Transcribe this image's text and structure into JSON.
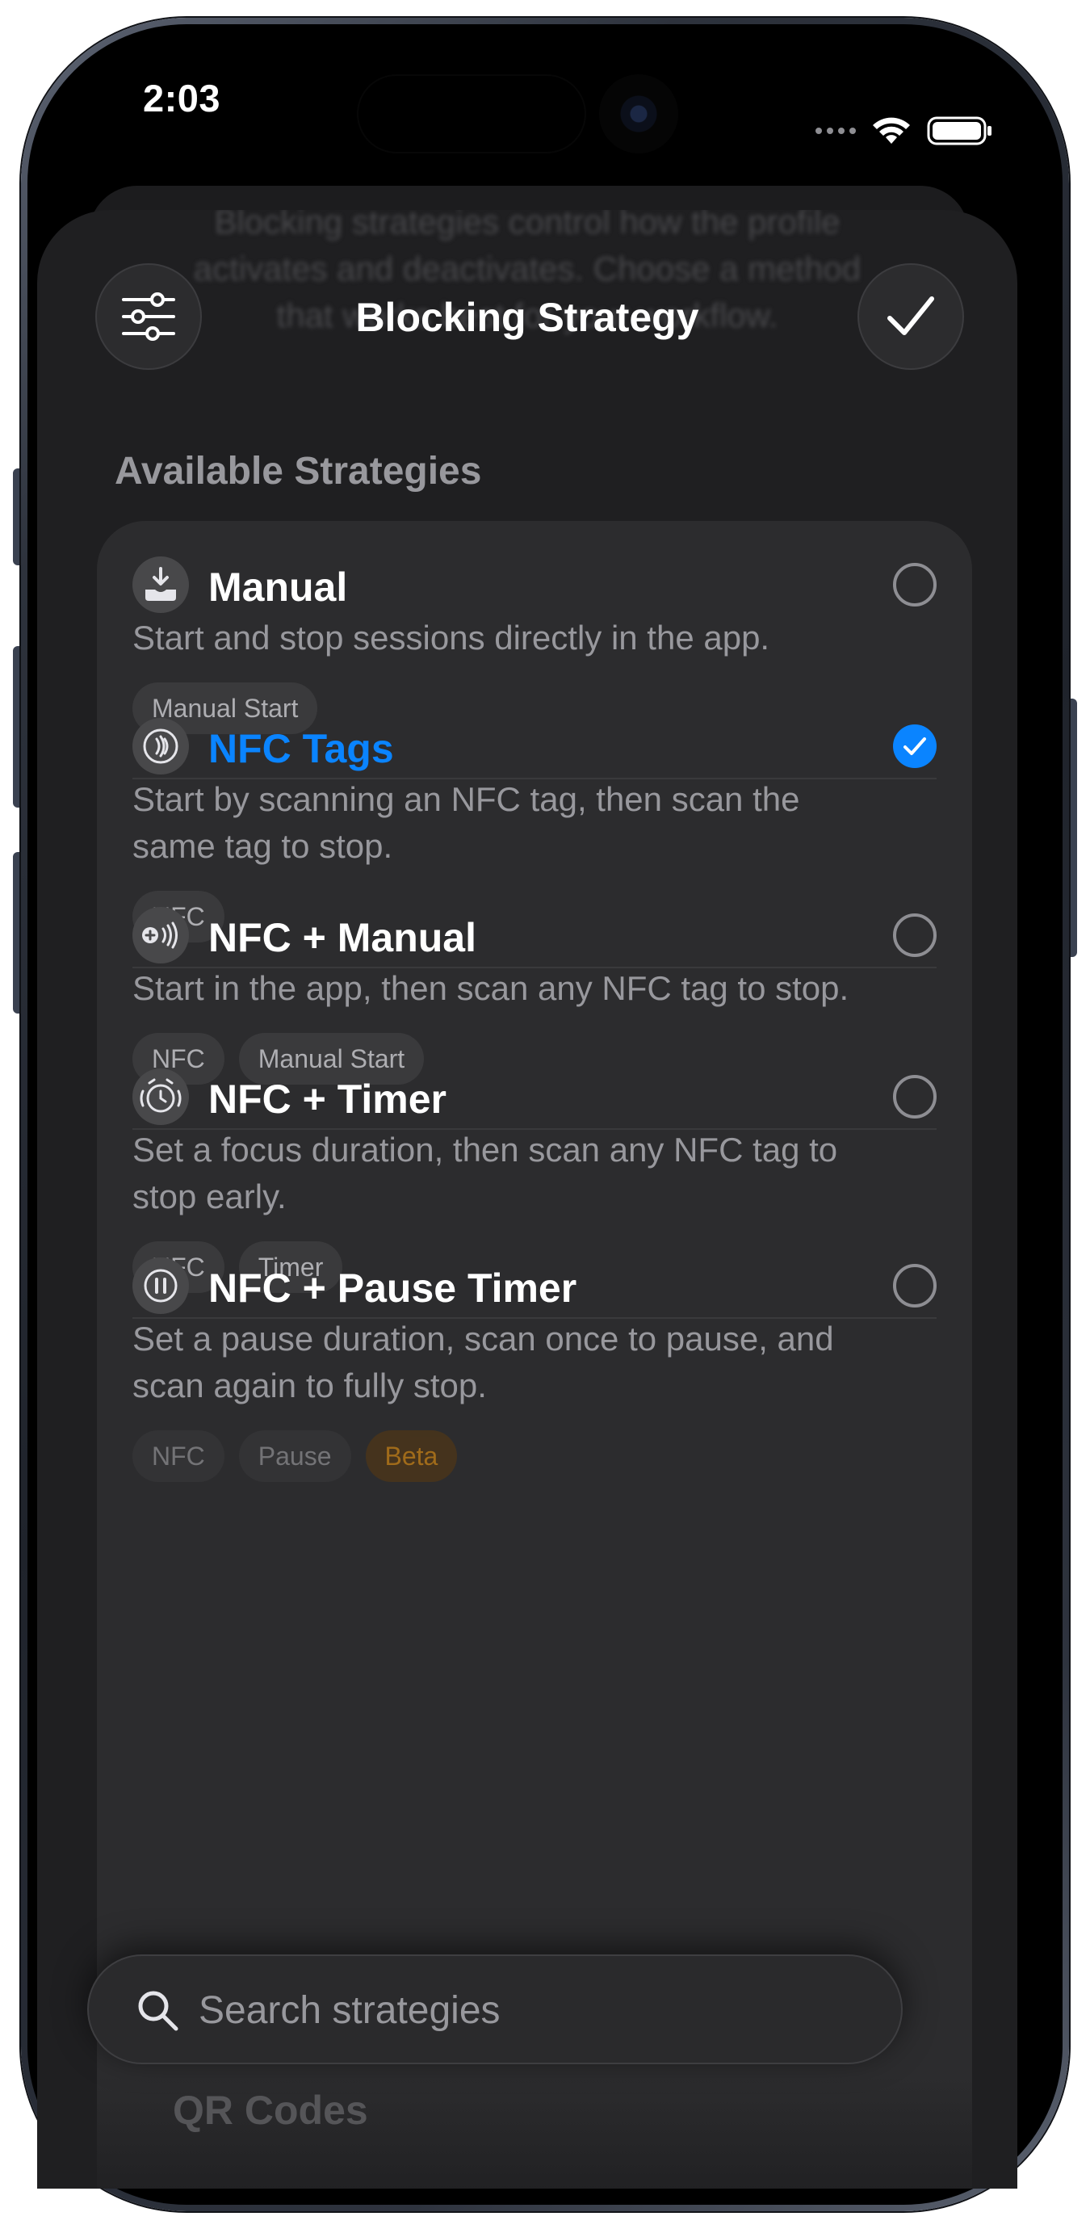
{
  "status_bar": {
    "time": "2:03"
  },
  "sheet": {
    "background_text": [
      "Blocking strategies control how the profile",
      "activates and deactivates. Choose a method",
      "that works best for your workflow."
    ],
    "title": "Blocking Strategy",
    "section_header": "Available Strategies"
  },
  "strategies": [
    {
      "icon": "manual-download-icon",
      "title": "Manual",
      "description_lines": [
        "Start and stop sessions directly in the app."
      ],
      "tags": [
        "Manual Start"
      ],
      "selected": false
    },
    {
      "icon": "nfc-waves-icon",
      "title": "NFC Tags",
      "description_lines": [
        "Start by scanning an NFC tag, then scan the",
        "same tag to stop."
      ],
      "tags": [
        "NFC"
      ],
      "selected": true
    },
    {
      "icon": "nfc-plus-icon",
      "title": "NFC + Manual",
      "description_lines": [
        "Start in the app, then scan any NFC tag to stop."
      ],
      "tags": [
        "NFC",
        "Manual Start"
      ],
      "selected": false
    },
    {
      "icon": "alarm-clock-icon",
      "title": "NFC + Timer",
      "description_lines": [
        "Set a focus duration, then scan any NFC tag to",
        "stop early."
      ],
      "tags": [
        "NFC",
        "Timer"
      ],
      "selected": false
    },
    {
      "icon": "pause-circle-icon",
      "title": "NFC + Pause Timer",
      "description_lines": [
        "Set a pause duration, scan once to pause, and",
        "scan again to fully stop."
      ],
      "tags": [
        "NFC",
        "Pause",
        "Beta"
      ],
      "selected": false
    },
    {
      "icon": "qr-code-icon",
      "title": "QR Codes",
      "selected": false
    }
  ],
  "search": {
    "placeholder": "Search strategies"
  },
  "colors": {
    "accent": "#0a84ff",
    "sheet_bg": "#1f1f21",
    "card_bg": "#2c2c2e",
    "secondary_text": "#98989d",
    "beta_tag": "#ff9f0a"
  }
}
